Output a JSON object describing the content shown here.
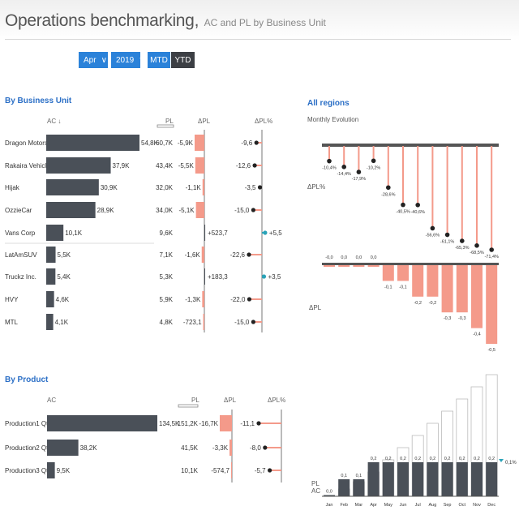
{
  "header": {
    "title": "Operations benchmarking,",
    "subtitle": "AC and PL by Business Unit"
  },
  "filters": {
    "month": "Apr",
    "year": "2019",
    "mtd_label": "MTD",
    "ytd_label": "YTD"
  },
  "business_unit": {
    "title": "By Business Unit",
    "col_ac": "AC ↓",
    "col_pl": "PL",
    "col_dpl": "ΔPL",
    "col_dplpct": "ΔPL%"
  },
  "regions": {
    "title": "All regions",
    "subtitle": "Monthly Evolution",
    "dplpct_label": "ΔPL%",
    "dpl_label": "ΔPL",
    "pl_label": "PL",
    "ac_label": "AC"
  },
  "product": {
    "title": "By Product",
    "col_ac": "AC",
    "col_pl": "PL",
    "col_dpl": "ΔPL",
    "col_dplpct": "ΔPL%"
  },
  "colors": {
    "ac_bar": "#4a5058",
    "negative": "#f49a8a",
    "positive": "#4a5058",
    "accent": "#2b82d9",
    "teal": "#2aa3b8",
    "section_title": "#2b6fc6"
  },
  "chart_data": [
    {
      "type": "bar",
      "id": "bu",
      "categories": [
        "Dragon Motors",
        "Rakaira Vehicles",
        "Hijak",
        "OzzieCar",
        "Vans Corp",
        "LatAmSUV",
        "Truckz Inc.",
        "HVY",
        "MTL"
      ],
      "series": [
        {
          "name": "AC",
          "values": [
            54.8,
            37.9,
            30.9,
            28.9,
            10.1,
            5.5,
            5.4,
            4.6,
            4.1
          ],
          "labels": [
            "54,8K",
            "37,9K",
            "30,9K",
            "28,9K",
            "10,1K",
            "5,5K",
            "5,4K",
            "4,6K",
            "4,1K"
          ]
        },
        {
          "name": "PL",
          "labels": [
            "60,7K",
            "43,4K",
            "32,0K",
            "34,0K",
            "9,6K",
            "7,1K",
            "5,3K",
            "5,9K",
            "4,8K"
          ]
        },
        {
          "name": "ΔPL",
          "values": [
            -5.9,
            -5.5,
            -1.1,
            -5.1,
            0.5237,
            -1.6,
            0.1833,
            -1.3,
            -0.7231
          ],
          "labels": [
            "-5,9K",
            "-5,5K",
            "-1,1K",
            "-5,1K",
            "+523,7",
            "-1,6K",
            "+183,3",
            "-1,3K",
            "-723,1"
          ]
        },
        {
          "name": "ΔPL%",
          "values": [
            -9.6,
            -12.6,
            -3.5,
            -15.0,
            5.5,
            -22.6,
            3.5,
            -22.0,
            -15.0
          ],
          "labels": [
            "-9,6",
            "-12,6",
            "-3,5",
            "-15,0",
            "+5,5",
            "-22,6",
            "+3,5",
            "-22,0",
            "-15,0"
          ]
        }
      ]
    },
    {
      "type": "bar",
      "id": "regions_dplpct",
      "categories": [
        "Jan",
        "Feb",
        "Mar",
        "Apr",
        "May",
        "Jun",
        "Jul",
        "Aug",
        "Sep",
        "Oct",
        "Nov",
        "Dec"
      ],
      "values": [
        -10.4,
        -14.4,
        -17.9,
        -10.2,
        -28.6,
        -40.5,
        -40.6,
        -56.6,
        -61.1,
        -65.3,
        -68.5,
        -71.4
      ],
      "labels": [
        "-10,4%",
        "-14,4%",
        "-17,9%",
        "-10,2%",
        "-28,6%",
        "-40,5%",
        "-40,6%",
        "-56,6%",
        "-61,1%",
        "-65,3%",
        "-68,5%",
        "-71,4%"
      ]
    },
    {
      "type": "bar",
      "id": "regions_dpl",
      "categories": [
        "Jan",
        "Feb",
        "Mar",
        "Apr",
        "May",
        "Jun",
        "Jul",
        "Aug",
        "Sep",
        "Oct",
        "Nov",
        "Dec"
      ],
      "values": [
        -0.0,
        -0.0,
        -0.0,
        -0.0,
        -0.1,
        -0.1,
        -0.2,
        -0.2,
        -0.3,
        -0.3,
        -0.4,
        -0.5
      ],
      "labels": [
        "-0,0",
        "0,0",
        "0,0",
        "0,0",
        "-0,1",
        "-0,1",
        "-0,2",
        "-0,2",
        "-0,3",
        "-0,3",
        "-0,4",
        "-0,5"
      ]
    },
    {
      "type": "bar",
      "id": "regions_ac_pl",
      "categories": [
        "Jan",
        "Feb",
        "Mar",
        "Apr",
        "May",
        "Jun",
        "Jul",
        "Aug",
        "Sep",
        "Oct",
        "Nov",
        "Dec"
      ],
      "series": [
        {
          "name": "AC",
          "values": [
            0.0,
            0.1,
            0.1,
            0.2,
            0.2,
            0.2,
            0.2,
            0.2,
            0.2,
            0.2,
            0.2,
            0.2
          ],
          "labels": [
            "0,0",
            "0,1",
            "0,1",
            "0,2",
            "0,2",
            "0,2",
            "0,2",
            "0,2",
            "0,2",
            "0,2",
            "0,2",
            "0,2"
          ]
        },
        {
          "name": "PL",
          "values": [
            0.0,
            0.06,
            0.12,
            0.2,
            0.3,
            0.4,
            0.5,
            0.6,
            0.7,
            0.8,
            0.9,
            1.0
          ]
        }
      ],
      "end_label": "0,1%"
    },
    {
      "type": "bar",
      "id": "product",
      "categories": [
        "Production1 Qty",
        "Production2 Qty",
        "Production3 Qty"
      ],
      "series": [
        {
          "name": "AC",
          "values": [
            134.5,
            38.2,
            9.5
          ],
          "labels": [
            "134,5K",
            "38,2K",
            "9,5K"
          ]
        },
        {
          "name": "PL",
          "labels": [
            "151,2K",
            "41,5K",
            "10,1K"
          ]
        },
        {
          "name": "ΔPL",
          "values": [
            -16.7,
            -3.3,
            -0.5747
          ],
          "labels": [
            "-16,7K",
            "-3,3K",
            "-574,7"
          ]
        },
        {
          "name": "ΔPL%",
          "values": [
            -11.1,
            -8.0,
            -5.7
          ],
          "labels": [
            "-11,1",
            "-8,0",
            "-5,7"
          ]
        }
      ]
    }
  ]
}
